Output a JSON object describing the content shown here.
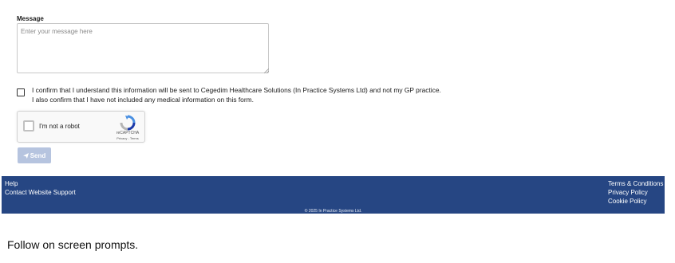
{
  "form": {
    "message_label": "Message",
    "message_placeholder": "Enter your message here",
    "message_value": "",
    "confirm_line1": "I confirm that I understand this information will be sent to Cegedim Healthcare Solutions (In Practice Systems Ltd) and not my GP practice.",
    "confirm_line2": "I also confirm that I have not included any medical information on this form.",
    "confirm_checked": false
  },
  "captcha": {
    "label": "I'm not a robot",
    "brand": "reCAPTCHA",
    "privacy": "Privacy",
    "separator": " - ",
    "terms": "Terms",
    "icon": "recaptcha-logo-icon"
  },
  "send": {
    "label": "Send",
    "icon": "paper-plane-icon",
    "color": "#b6c4df"
  },
  "footer": {
    "color": "#264683",
    "left_links": [
      "Help",
      "Contact Website Support"
    ],
    "right_links": [
      "Terms & Conditions",
      "Privacy Policy",
      "Cookie Policy"
    ],
    "copyright": "© 2025 In Practice Systems Ltd."
  },
  "caption": "Follow on screen prompts."
}
